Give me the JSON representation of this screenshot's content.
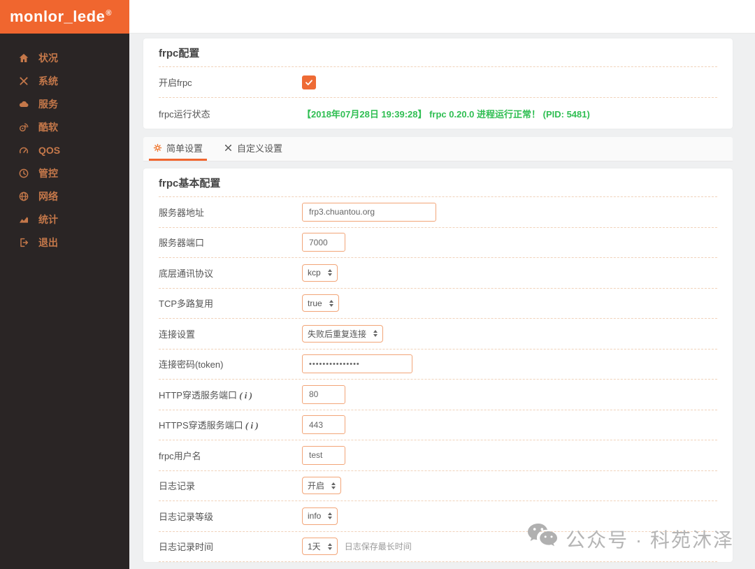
{
  "logo": {
    "text": "monlor_lede",
    "reg": "®"
  },
  "sidebar": {
    "items": [
      {
        "id": "status",
        "icon": "home",
        "label": "状况"
      },
      {
        "id": "system",
        "icon": "tools",
        "label": "系统"
      },
      {
        "id": "services",
        "icon": "cloud",
        "label": "服务"
      },
      {
        "id": "kusoft",
        "icon": "weibo",
        "label": "酷软"
      },
      {
        "id": "qos",
        "icon": "gauge",
        "label": "QOS"
      },
      {
        "id": "control",
        "icon": "clock",
        "label": "管控"
      },
      {
        "id": "network",
        "icon": "globe",
        "label": "网络"
      },
      {
        "id": "stats",
        "icon": "chart",
        "label": "统计"
      },
      {
        "id": "logout",
        "icon": "logout",
        "label": "退出"
      }
    ]
  },
  "section1": {
    "title": "frpc配置",
    "rows": [
      {
        "label": "开启frpc",
        "type": "checkbox",
        "checked": true
      },
      {
        "label": "frpc运行状态",
        "type": "status",
        "value": "【2018年07月28日 19:39:28】  frpc 0.20.0 进程运行正常！ (PID: 5481)"
      }
    ]
  },
  "tabs": [
    {
      "id": "simple",
      "icon": "gear",
      "label": "简单设置",
      "active": true
    },
    {
      "id": "custom",
      "icon": "tools",
      "label": "自定义设置",
      "active": false
    }
  ],
  "section2": {
    "title": "frpc基本配置",
    "rows": [
      {
        "label": "服务器地址",
        "type": "text",
        "value": "frp3.chuantou.org"
      },
      {
        "label": "服务器端口",
        "type": "text",
        "value": "7000"
      },
      {
        "label": "底层通讯协议",
        "type": "select",
        "value": "kcp"
      },
      {
        "label": "TCP多路复用",
        "type": "select",
        "value": "true"
      },
      {
        "label": "连接设置",
        "type": "select",
        "value": "失败后重复连接"
      },
      {
        "label": "连接密码(token)",
        "type": "password",
        "value": "•••••••••••••••"
      },
      {
        "label": "HTTP穿透服务端口",
        "info": "i",
        "type": "text",
        "value": "80"
      },
      {
        "label": "HTTPS穿透服务端口",
        "info": "i",
        "type": "text",
        "value": "443"
      },
      {
        "label": "frpc用户名",
        "type": "text",
        "value": "test"
      },
      {
        "label": "日志记录",
        "type": "select",
        "value": "开启"
      },
      {
        "label": "日志记录等级",
        "type": "select",
        "value": "info"
      },
      {
        "label": "日志记录时间",
        "type": "select",
        "value": "1天",
        "hint": "日志保存最长时间"
      }
    ]
  },
  "watermark": {
    "text": "公众号 · 科苑沐泽"
  },
  "colors": {
    "accent_orange": "#f0662f",
    "checkbox_orange": "#ee6b35",
    "input_border": "#f2a578",
    "status_green": "#2fbe52",
    "sidebar_bg": "#2a2525",
    "sidebar_text": "#c5784a",
    "watermark_gray": "#b5b5b5"
  }
}
